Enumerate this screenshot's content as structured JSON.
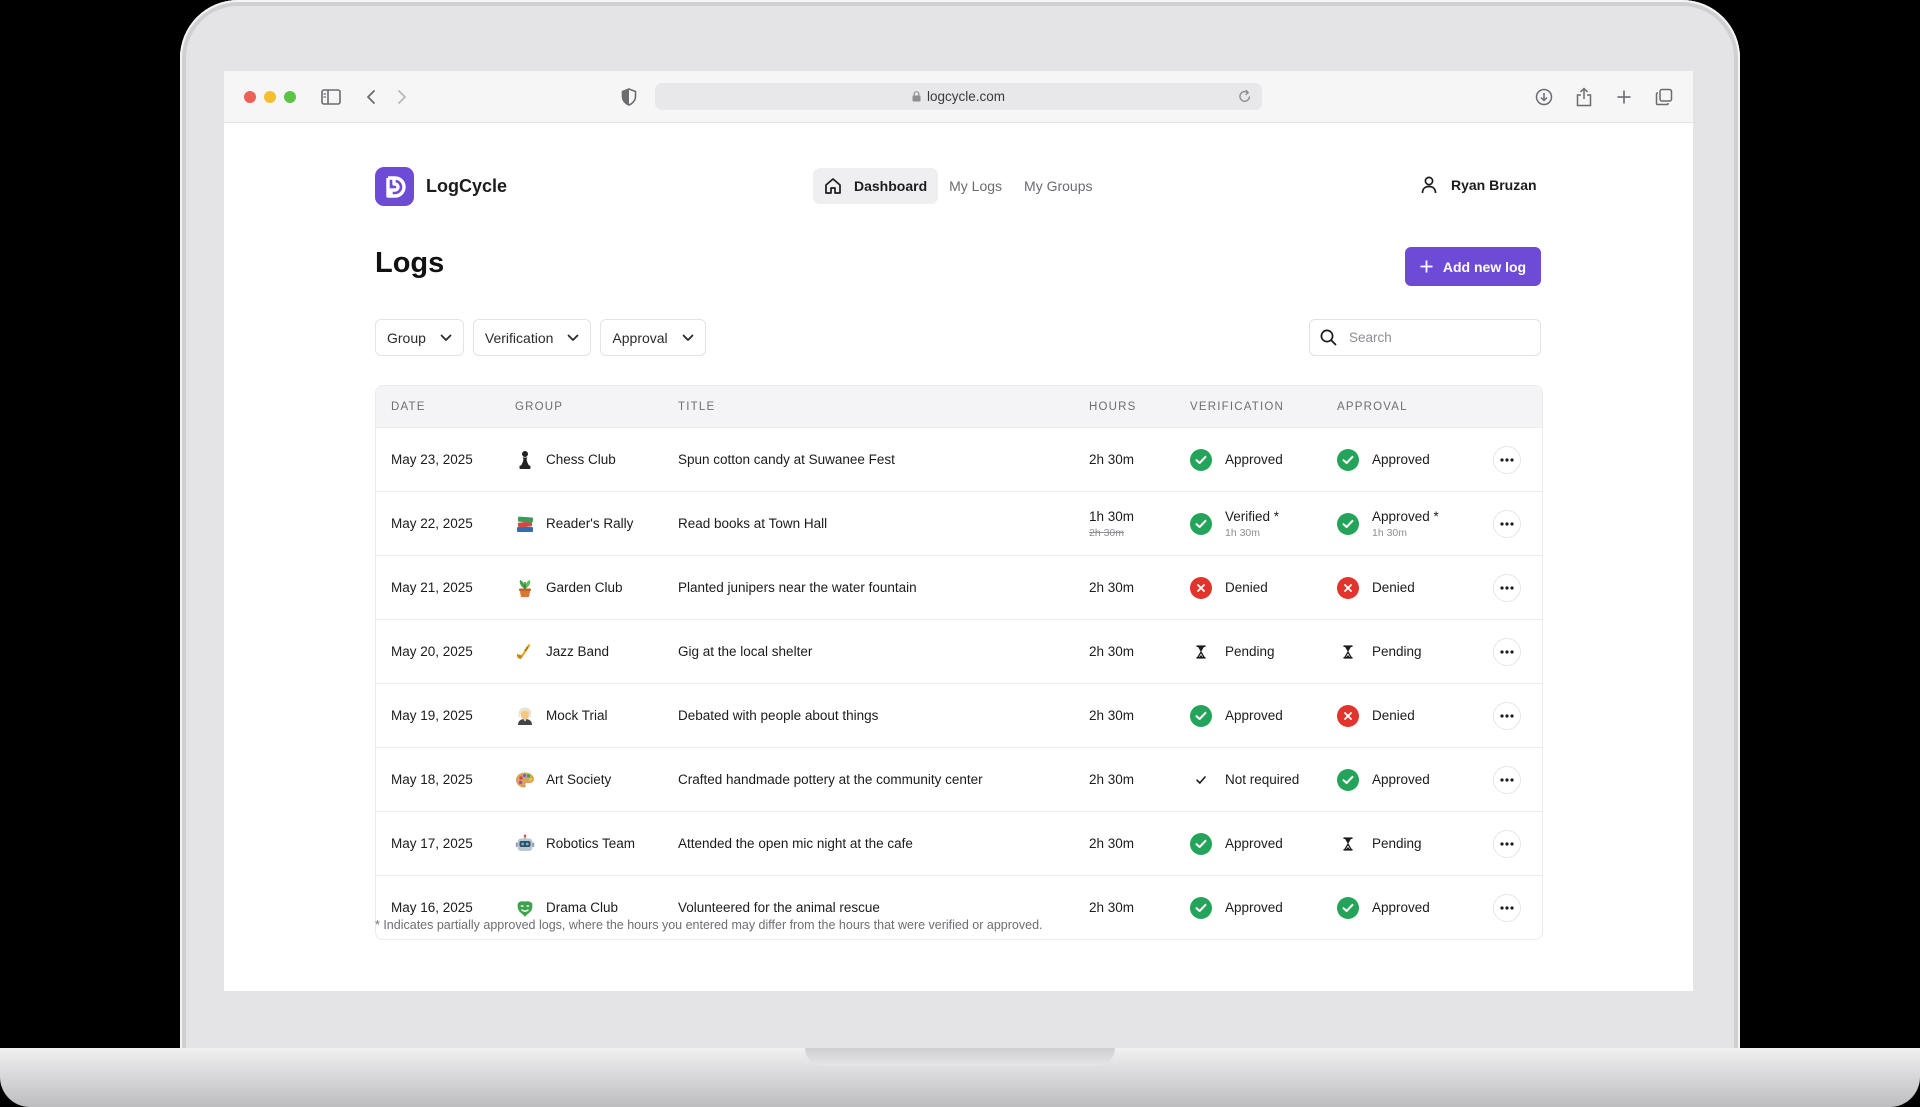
{
  "browser": {
    "url": "logcycle.com"
  },
  "app": {
    "name": "LogCycle",
    "nav": [
      {
        "label": "Dashboard",
        "active": true
      },
      {
        "label": "My Logs",
        "active": false
      },
      {
        "label": "My Groups",
        "active": false
      }
    ],
    "user_name": "Ryan Bruzan"
  },
  "page": {
    "title": "Logs",
    "add_button_label": "Add new log",
    "filters": [
      "Group",
      "Verification",
      "Approval"
    ],
    "search_placeholder": "Search",
    "footnote": "* Indicates partially approved logs, where the hours you entered may differ from the hours that were verified or approved."
  },
  "table": {
    "columns": [
      "DATE",
      "GROUP",
      "TITLE",
      "HOURS",
      "VERIFICATION",
      "APPROVAL"
    ],
    "rows": [
      {
        "date": "May 23, 2025",
        "group": "Chess Club",
        "group_icon": "chess-pawn",
        "title": "Spun cotton candy at Suwanee Fest",
        "hours": "2h 30m",
        "verification": "Approved",
        "verification_status": "approved",
        "approval": "Approved",
        "approval_status": "approved"
      },
      {
        "date": "May 22, 2025",
        "group": "Reader's Rally",
        "group_icon": "books",
        "title": "Read books at Town Hall",
        "hours": "1h 30m",
        "hours_original": "2h 30m",
        "verification": "Verified *",
        "verification_sub": "1h 30m",
        "verification_status": "approved",
        "approval": "Approved *",
        "approval_sub": "1h 30m",
        "approval_status": "approved"
      },
      {
        "date": "May 21, 2025",
        "group": "Garden Club",
        "group_icon": "potted-plant",
        "title": "Planted junipers near the water fountain",
        "hours": "2h 30m",
        "verification": "Denied",
        "verification_status": "denied",
        "approval": "Denied",
        "approval_status": "denied"
      },
      {
        "date": "May 20, 2025",
        "group": "Jazz Band",
        "group_icon": "saxophone",
        "title": "Gig at the local shelter",
        "hours": "2h 30m",
        "verification": "Pending",
        "verification_status": "pending",
        "approval": "Pending",
        "approval_status": "pending"
      },
      {
        "date": "May 19, 2025",
        "group": "Mock Trial",
        "group_icon": "judge",
        "title": "Debated with people about things",
        "hours": "2h 30m",
        "verification": "Approved",
        "verification_status": "approved",
        "approval": "Denied",
        "approval_status": "denied"
      },
      {
        "date": "May 18, 2025",
        "group": "Art Society",
        "group_icon": "palette",
        "title": "Crafted handmade pottery at the community center",
        "hours": "2h 30m",
        "verification": "Not required",
        "verification_status": "not-required",
        "approval": "Approved",
        "approval_status": "approved"
      },
      {
        "date": "May 17, 2025",
        "group": "Robotics Team",
        "group_icon": "robot",
        "title": "Attended the open mic night at the cafe",
        "hours": "2h 30m",
        "verification": "Approved",
        "verification_status": "approved",
        "approval": "Pending",
        "approval_status": "pending"
      },
      {
        "date": "May 16, 2025",
        "group": "Drama Club",
        "group_icon": "mask",
        "title": "Volunteered for the animal rescue",
        "hours": "2h 30m",
        "verification": "Approved",
        "verification_status": "approved",
        "approval": "Approved",
        "approval_status": "approved"
      }
    ]
  },
  "colors": {
    "brand": "#6d4bd6",
    "approved": "#23a45a",
    "denied": "#e0342c"
  }
}
